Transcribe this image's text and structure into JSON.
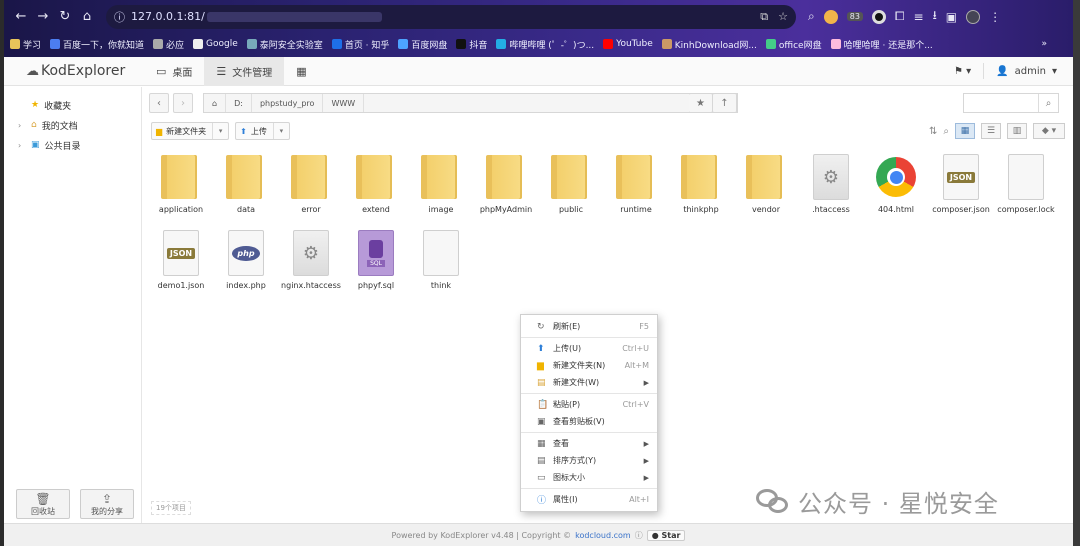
{
  "browser": {
    "address": "127.0.0.1:81/",
    "bookmarks": [
      "学习",
      "百度一下，你就知道",
      "必应",
      "Google",
      "泰阿安全实验室",
      "首页 · 知乎",
      "百度网盘",
      "抖音",
      "哔哩哔哩 (゜-゜)つ...",
      "YouTube",
      "KinhDownload网...",
      "office网盘",
      "哈哩哈哩 · 还是那个..."
    ],
    "ext_badge": "83"
  },
  "app": {
    "logo": "KodExplorer",
    "tabs": [
      "桌面",
      "文件管理"
    ],
    "user": "admin"
  },
  "sidebar": {
    "items": [
      "收藏夹",
      "我的文档",
      "公共目录"
    ],
    "recycle": "回收站",
    "share": "我的分享"
  },
  "path": {
    "segments": [
      "D:",
      "phpstudy_pro",
      "WWW"
    ]
  },
  "actions": {
    "new_folder": "新建文件夹",
    "upload": "上传"
  },
  "files": [
    {
      "name": "application",
      "type": "folder"
    },
    {
      "name": "data",
      "type": "folder"
    },
    {
      "name": "error",
      "type": "folder"
    },
    {
      "name": "extend",
      "type": "folder"
    },
    {
      "name": "image",
      "type": "folder"
    },
    {
      "name": "phpMyAdmin",
      "type": "folder"
    },
    {
      "name": "public",
      "type": "folder"
    },
    {
      "name": "runtime",
      "type": "folder"
    },
    {
      "name": "thinkphp",
      "type": "folder"
    },
    {
      "name": "vendor",
      "type": "folder"
    },
    {
      "name": ".htaccess",
      "type": "config"
    },
    {
      "name": "404.html",
      "type": "chrome"
    },
    {
      "name": "composer.json",
      "type": "json"
    },
    {
      "name": "composer.lock",
      "type": "blank"
    },
    {
      "name": "demo1.json",
      "type": "json"
    },
    {
      "name": "index.php",
      "type": "php"
    },
    {
      "name": "nginx.htaccess",
      "type": "config"
    },
    {
      "name": "phpyf.sql",
      "type": "sql"
    },
    {
      "name": "think",
      "type": "blank"
    }
  ],
  "badges": {
    "json": "JSON",
    "php": "php",
    "sql": "SQL"
  },
  "context_menu": {
    "refresh": {
      "label": "刷新(E)",
      "shortcut": "F5"
    },
    "upload": {
      "label": "上传(U)",
      "shortcut": "Ctrl+U"
    },
    "new_folder": {
      "label": "新建文件夹(N)",
      "shortcut": "Alt+M"
    },
    "new_file": {
      "label": "新建文件(W)"
    },
    "paste": {
      "label": "粘贴(P)",
      "shortcut": "Ctrl+V"
    },
    "view_clipboard": {
      "label": "查看剪贴板(V)"
    },
    "view": {
      "label": "查看"
    },
    "sort": {
      "label": "排序方式(Y)"
    },
    "icon_size": {
      "label": "图标大小"
    },
    "properties": {
      "label": "属性(I)",
      "shortcut": "Alt+I"
    }
  },
  "status": "19个项目",
  "footer": {
    "powered": "Powered by KodExplorer v4.48 | Copyright ©",
    "link": "kodcloud.com",
    "star": "Star"
  },
  "watermark": "公众号 · 星悦安全"
}
